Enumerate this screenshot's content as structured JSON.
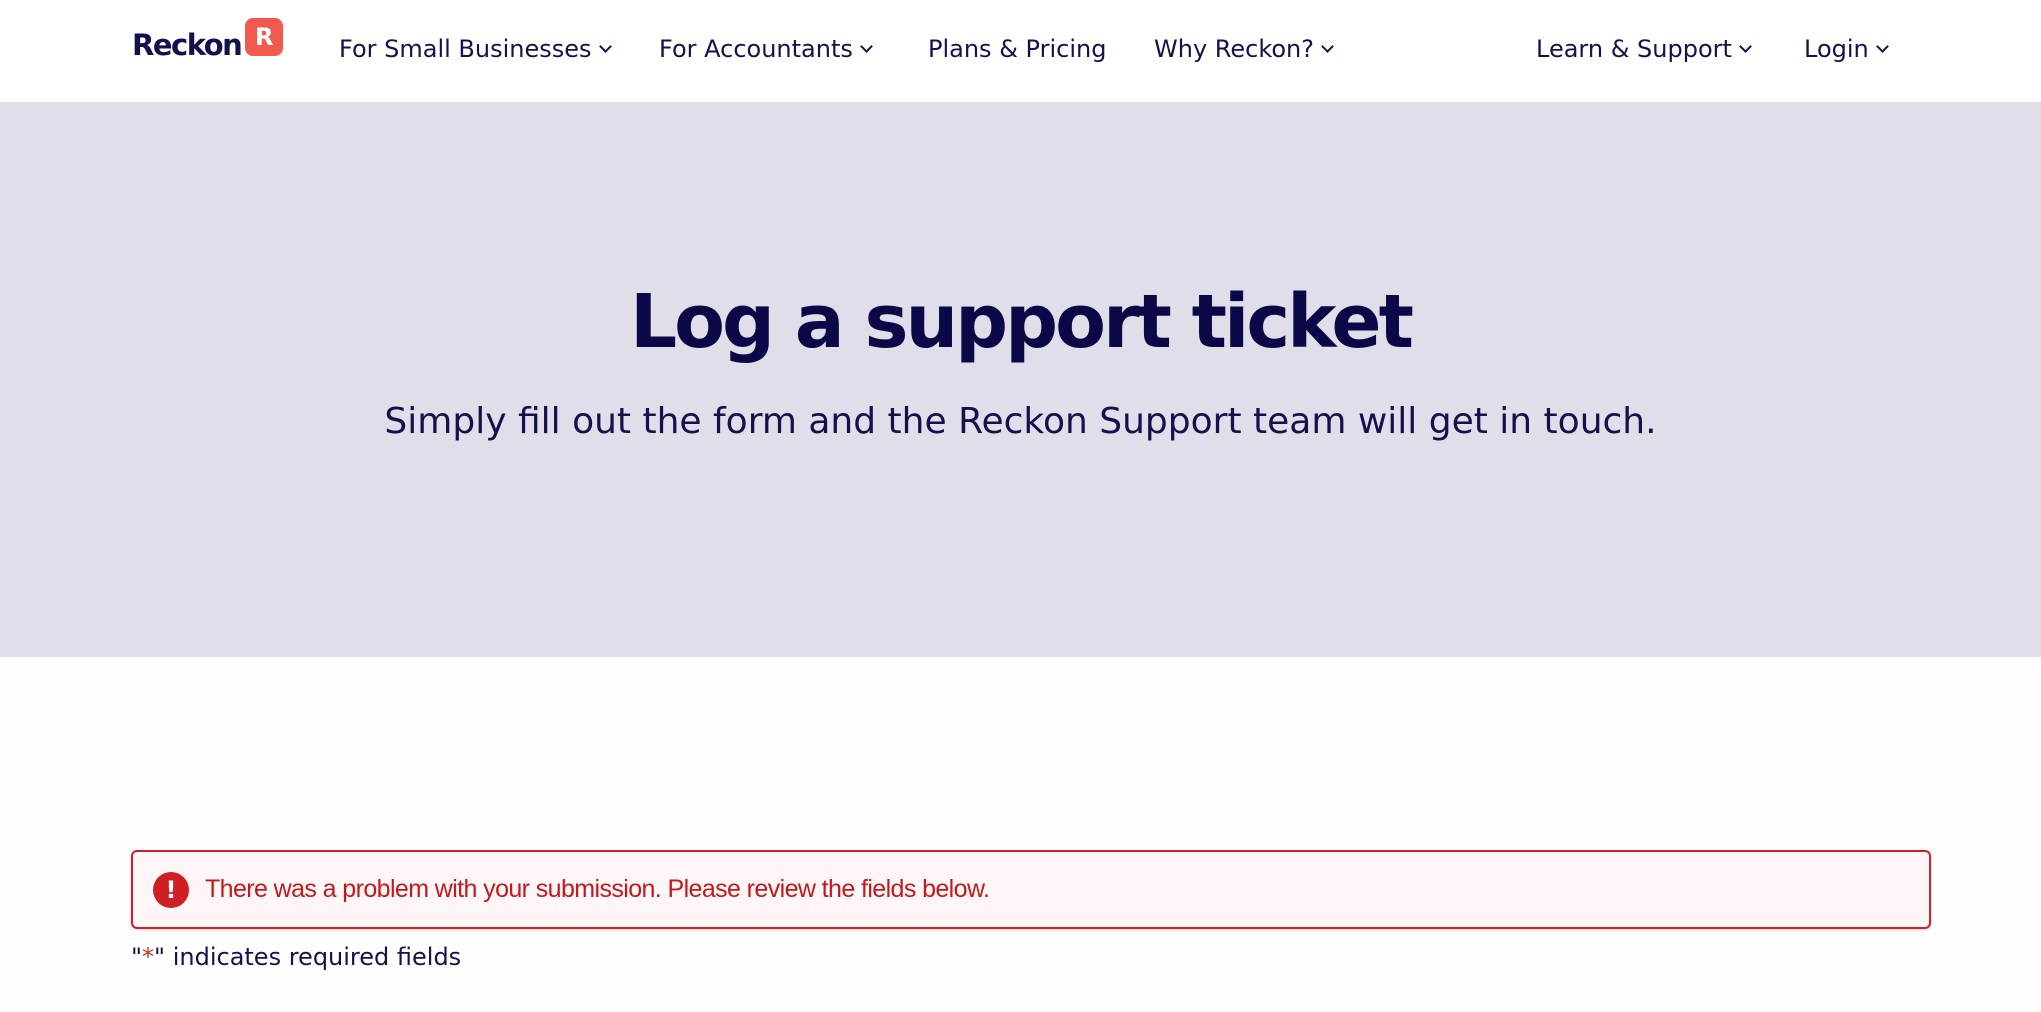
{
  "header": {
    "logo": {
      "text": "Reckon",
      "badge": "R"
    },
    "nav": {
      "small_businesses": "For Small Businesses",
      "accountants": "For Accountants",
      "plans_pricing": "Plans & Pricing",
      "why_reckon": "Why Reckon?",
      "learn_support": "Learn & Support",
      "login": "Login"
    }
  },
  "hero": {
    "title": "Log a support ticket",
    "subtitle": "Simply fill out the form and the Reckon Support team will get in touch."
  },
  "form": {
    "error": {
      "icon": "!",
      "message": "There was a problem with your submission. Please review the fields below."
    },
    "required_note": {
      "open_quote": "\"",
      "asterisk": "*",
      "rest": "\" indicates required fields"
    }
  },
  "colors": {
    "brand_navy": "#0f0a4a",
    "brand_coral": "#f25a4f",
    "hero_bg": "#dfdee9",
    "error_red": "#c9232a"
  }
}
